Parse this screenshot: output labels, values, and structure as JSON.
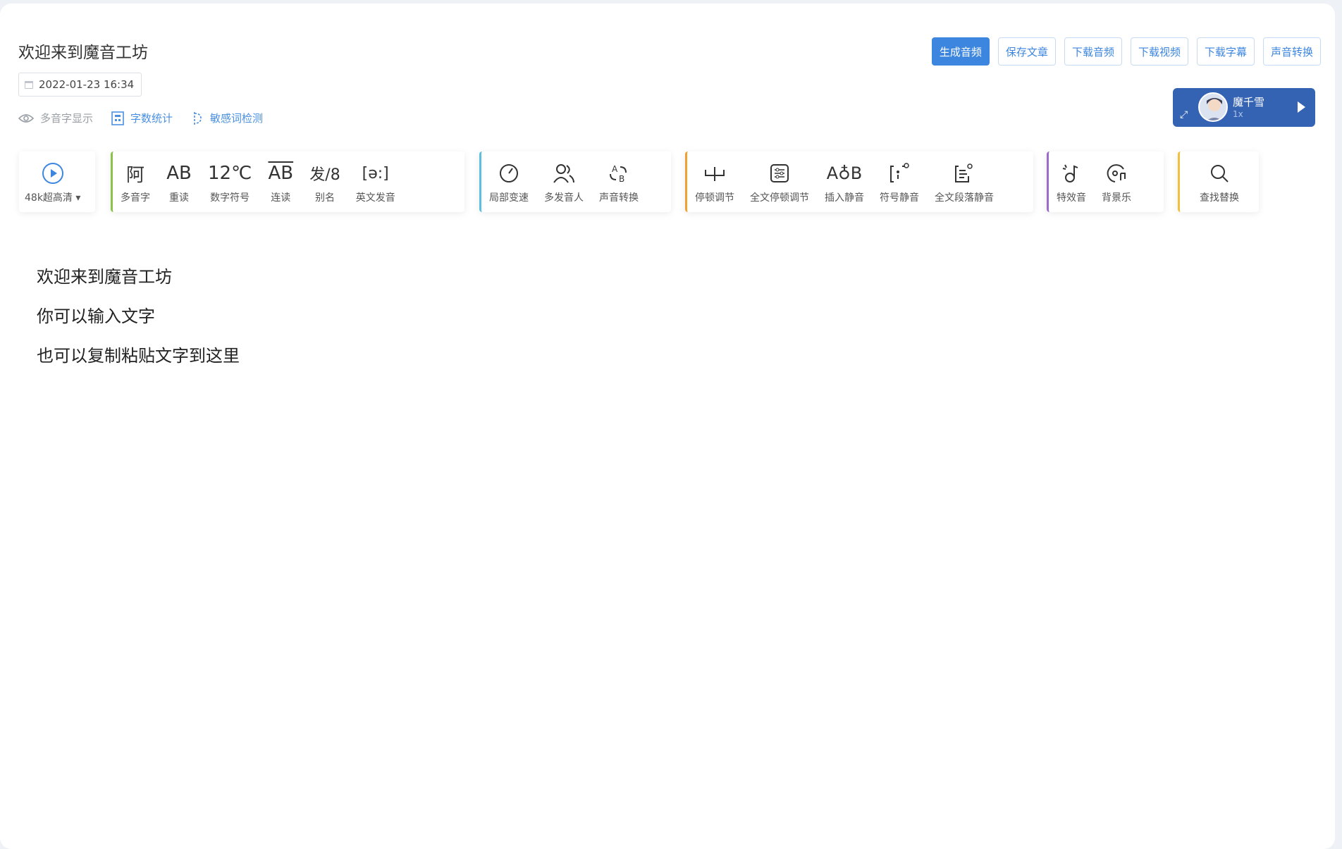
{
  "header": {
    "title": "欢迎来到魔音工坊",
    "date": "2022-01-23 16:34",
    "options": [
      {
        "label": "多音字显示",
        "icon": "eye-icon",
        "color": "#9aa0a6"
      },
      {
        "label": "字数统计",
        "icon": "calculator-icon",
        "color": "#4a90e2"
      },
      {
        "label": "敏感词检测",
        "icon": "sensitive-word-icon",
        "color": "#4a90e2"
      }
    ]
  },
  "top_buttons": {
    "generate": "生成音频",
    "save": "保存文章",
    "download_audio": "下载音频",
    "download_video": "下载视频",
    "download_subtitle": "下载字幕",
    "voice_convert": "声音转换"
  },
  "player": {
    "name": "魔千雪",
    "speed": "1x"
  },
  "toolbar": {
    "quality": {
      "label": "48k超高清"
    },
    "group1": [
      {
        "label": "多音字",
        "icon_text": "阿"
      },
      {
        "label": "重读",
        "icon_text": "AB"
      },
      {
        "label": "数字符号",
        "icon_text": "12℃"
      },
      {
        "label": "连读",
        "icon_text": "AB"
      },
      {
        "label": "别名",
        "icon_text": "发/8"
      },
      {
        "label": "英文发音",
        "icon_text": "[ə:]"
      }
    ],
    "group2": [
      {
        "label": "局部变速"
      },
      {
        "label": "多发音人"
      },
      {
        "label": "声音转换"
      }
    ],
    "group3": [
      {
        "label": "停顿调节"
      },
      {
        "label": "全文停顿调节"
      },
      {
        "label": "插入静音",
        "icon_text": "A♁B"
      },
      {
        "label": "符号静音"
      },
      {
        "label": "全文段落静音"
      }
    ],
    "group4": [
      {
        "label": "特效音"
      },
      {
        "label": "背景乐"
      }
    ],
    "group5": [
      {
        "label": "查找替换"
      }
    ]
  },
  "colors": {
    "accent": "#3d86e0",
    "group1_border": "#8bc34a",
    "group2_border": "#5bc0de",
    "group3_border": "#f0a030",
    "group4_border": "#9b6cc9",
    "group5_border": "#f0c040",
    "player_bg": "#3563b3"
  },
  "editor": {
    "lines": [
      "欢迎来到魔音工坊",
      "你可以输入文字",
      "也可以复制粘贴文字到这里"
    ]
  }
}
